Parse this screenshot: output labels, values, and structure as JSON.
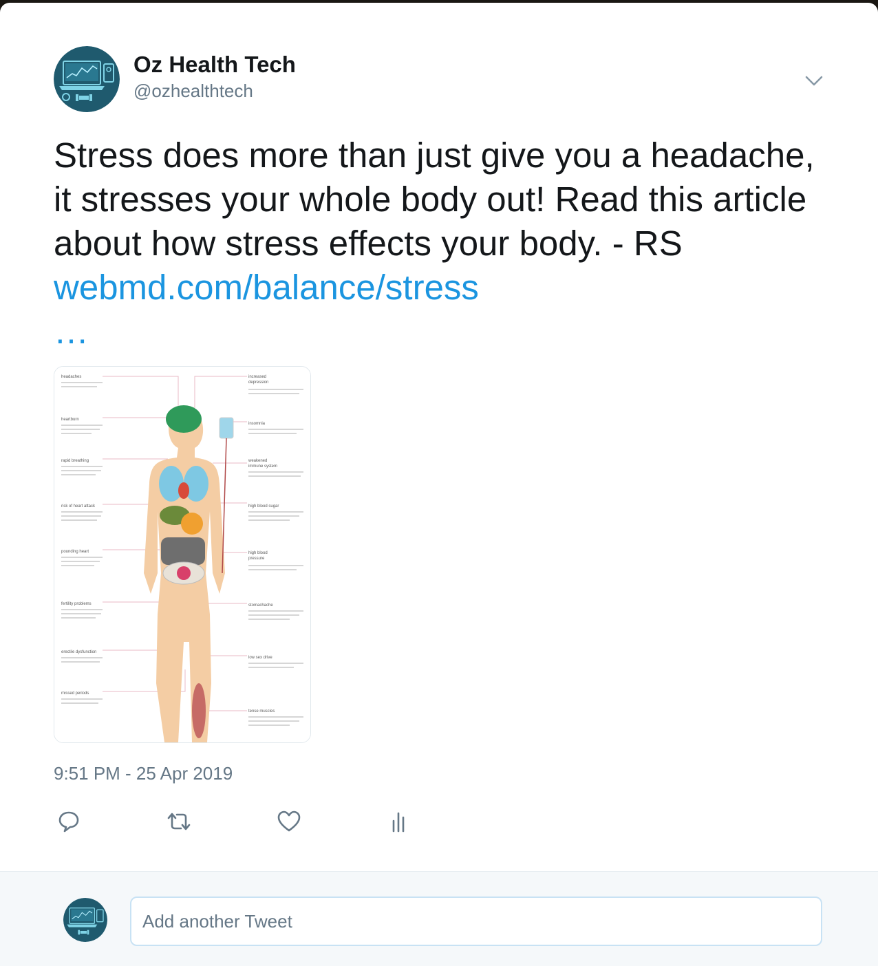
{
  "author": {
    "display_name": "Oz Health Tech",
    "handle": "@ozhealthtech",
    "avatar_icon": "laptop-fitness-logo-icon"
  },
  "tweet": {
    "text": "Stress does more than just give you a headache, it stresses your whole body out! Read this article about how stress effects your body. - RS ",
    "link_text": "webmd.com/balance/stress",
    "link_ellipsis": "…",
    "timestamp": "9:51 PM - 25 Apr 2019"
  },
  "media": {
    "type": "infographic",
    "left_labels": [
      "headaches",
      "heartburn",
      "rapid breathing",
      "risk of heart attack",
      "pounding heart",
      "fertility problems",
      "erectile dysfunction",
      "missed periods"
    ],
    "right_labels": [
      "increased depression",
      "insomnia",
      "weakened immune system",
      "high blood sugar",
      "high blood pressure",
      "stomachache",
      "low sex drive",
      "tense muscles"
    ]
  },
  "actions": {
    "reply_icon": "reply-icon",
    "retweet_icon": "retweet-icon",
    "like_icon": "heart-icon",
    "analytics_icon": "analytics-icon"
  },
  "reply_bar": {
    "placeholder": "Add another Tweet"
  },
  "colors": {
    "link": "#1b95e0",
    "secondary_text": "#657786",
    "avatar_bg": "#1f5a6e",
    "reply_bar_bg": "#f5f8fa",
    "input_border": "#c8e2f4"
  }
}
